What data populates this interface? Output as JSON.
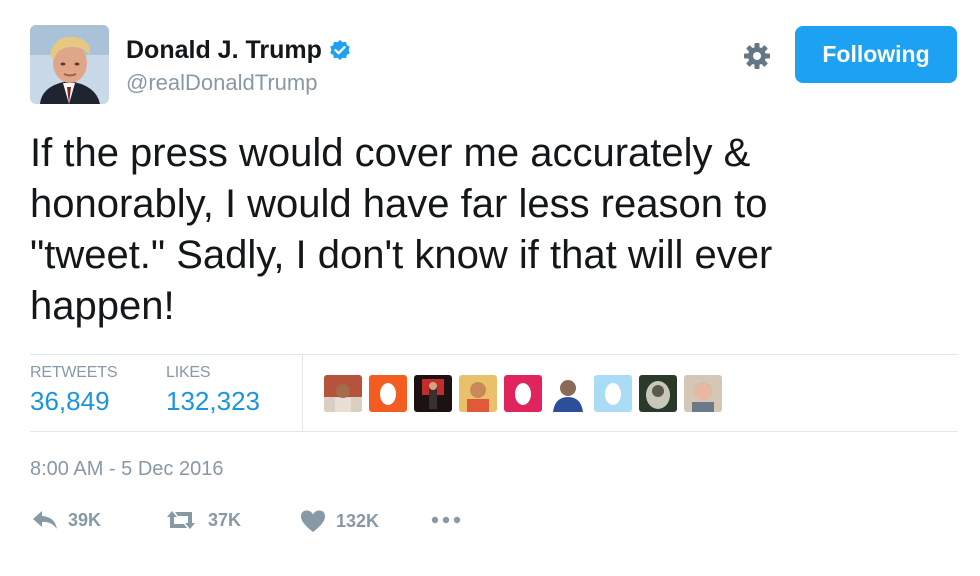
{
  "user": {
    "name": "Donald J. Trump",
    "handle": "@realDonaldTrump",
    "verified_icon": "verified-badge-icon",
    "avatar_icon": "profile-avatar"
  },
  "header": {
    "follow_button_label": "Following",
    "settings_icon": "gear-icon"
  },
  "tweet": {
    "text": "If the press would cover me accurately &\nhonorably, I would have far less reason to\n\"tweet.\" Sadly, I don't know if that will ever\nhappen!",
    "timestamp": "8:00 AM - 5 Dec 2016"
  },
  "stats": {
    "retweets_label": "RETWEETS",
    "retweets_value": "36,849",
    "likes_label": "LIKES",
    "likes_value": "132,323"
  },
  "likers": [
    {
      "icon": "liker-avatar-photo"
    },
    {
      "icon": "default-egg-avatar"
    },
    {
      "icon": "liker-avatar-photo"
    },
    {
      "icon": "liker-avatar-photo"
    },
    {
      "icon": "default-egg-avatar"
    },
    {
      "icon": "liker-avatar-photo"
    },
    {
      "icon": "default-egg-avatar"
    },
    {
      "icon": "liker-avatar-photo"
    },
    {
      "icon": "liker-avatar-photo"
    }
  ],
  "actions": {
    "reply_count": "39K",
    "retweet_count": "37K",
    "like_count": "132K",
    "more_icon": "more-dots-icon"
  },
  "colors": {
    "accent": "#1da1f2",
    "link": "#1b95e0",
    "muted": "#8899a6",
    "text": "#14171a",
    "divider": "#e1e8ed"
  }
}
